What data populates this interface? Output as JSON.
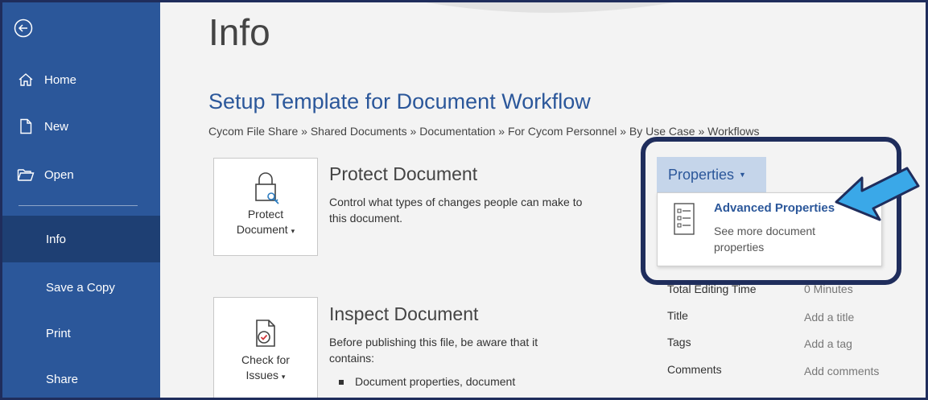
{
  "sidebar": {
    "items": [
      {
        "label": "Home",
        "icon": "home-icon"
      },
      {
        "label": "New",
        "icon": "new-document-icon"
      },
      {
        "label": "Open",
        "icon": "folder-open-icon"
      },
      {
        "label": "Info"
      },
      {
        "label": "Save a Copy"
      },
      {
        "label": "Print"
      },
      {
        "label": "Share"
      }
    ],
    "active": "Info"
  },
  "main": {
    "page_title": "Info",
    "doc_title": "Setup Template for Document Workflow",
    "breadcrumb": "Cycom File Share » Shared Documents » Documentation » For Cycom Personnel » By Use Case » Workflows",
    "protect": {
      "tile_line1": "Protect",
      "tile_line2": "Document",
      "title": "Protect Document",
      "desc": "Control what types of changes people can make to this document."
    },
    "inspect": {
      "tile_line1": "Check for",
      "tile_line2": "Issues",
      "title": "Inspect Document",
      "desc": "Before publishing this file, be aware that it contains:",
      "bullet": "Document properties, document"
    }
  },
  "properties": {
    "button_label": "Properties",
    "menu": {
      "title": "Advanced Properties",
      "desc": "See more document properties"
    },
    "rows": [
      {
        "name": "Total Editing Time",
        "value": "0 Minutes"
      },
      {
        "name": "Title",
        "value": "Add a title"
      },
      {
        "name": "Tags",
        "value": "Add a tag"
      },
      {
        "name": "Comments",
        "value": "Add comments"
      }
    ]
  },
  "colors": {
    "sidebar": "#2b579a",
    "sidebar_active": "#1e3f73",
    "accent": "#2b579a",
    "highlight_border": "#1f2d5c",
    "arrow": "#3aa8e8"
  }
}
